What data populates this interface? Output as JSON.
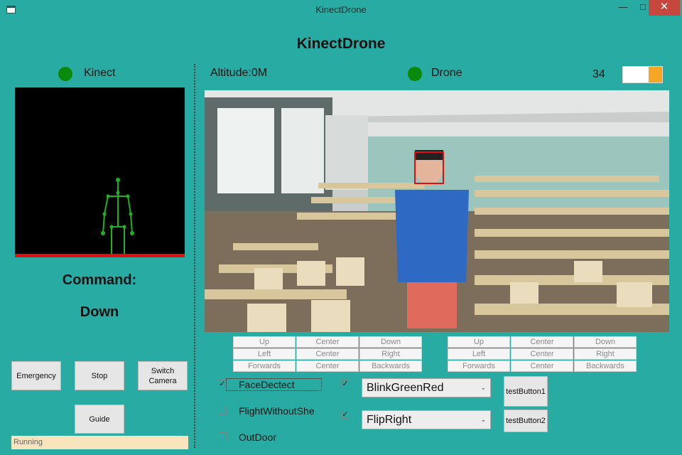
{
  "window": {
    "title": "KinectDrone",
    "minimize": "—",
    "maximize": "□",
    "close": "✕",
    "app_icon": "app-window-icon"
  },
  "app_title": "KinectDrone",
  "kinect": {
    "label": "Kinect",
    "status_color": "#0A8A0A"
  },
  "command": {
    "label": "Command:",
    "value": "Down"
  },
  "buttons": {
    "emergency": "Emergency",
    "stop": "Stop",
    "switch_camera": "Switch Camera",
    "guide": "Guide",
    "test1": "testButton1",
    "test2": "testButton2"
  },
  "status_text": "Running",
  "altitude": "Altitude:0M",
  "drone": {
    "label": "Drone",
    "status_color": "#0A8A0A"
  },
  "battery": {
    "value": "34",
    "level": 0.34,
    "fill_color": "#F5A623"
  },
  "direction_grid_left": [
    "Up",
    "Center",
    "Down",
    "Left",
    "Center",
    "Right",
    "Forwards",
    "Center",
    "Backwards"
  ],
  "direction_grid_right": [
    "Up",
    "Center",
    "Down",
    "Left",
    "Center",
    "Right",
    "Forwards",
    "Center",
    "Backwards"
  ],
  "checkboxes": [
    {
      "label": "FaceDectect",
      "checked": true
    },
    {
      "label": "FlightWithoutShe",
      "checked": false
    },
    {
      "label": "OutDoor",
      "checked": false
    }
  ],
  "combos": [
    {
      "value": "BlinkGreenRed",
      "checked": true
    },
    {
      "value": "FlipRight",
      "checked": true
    }
  ]
}
